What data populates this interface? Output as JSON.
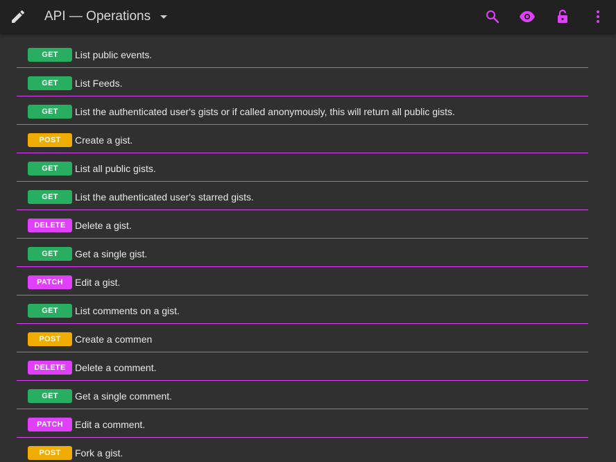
{
  "toolbar": {
    "title": "API — Operations",
    "edit_icon": "pencil-icon",
    "title_dropdown_icon": "caret-down-icon",
    "search_icon": "search-icon",
    "view_icon": "eye-icon",
    "lock_icon": "lock-icon",
    "more_icon": "more-vert-icon"
  },
  "colors": {
    "toolbar_bg": "#212121",
    "content_bg": "#303030",
    "divider": "#e040fb",
    "get": "#27ae60",
    "post": "#f0ad00",
    "delete": "#e040fb",
    "patch": "#e040fb"
  },
  "operations": [
    {
      "method": "GET",
      "summary": "List public events."
    },
    {
      "method": "GET",
      "summary": "List Feeds."
    },
    {
      "method": "GET",
      "summary": "List the authenticated user's gists or if called anonymously, this will return all public gists."
    },
    {
      "method": "POST",
      "summary": "Create a gist."
    },
    {
      "method": "GET",
      "summary": "List all public gists."
    },
    {
      "method": "GET",
      "summary": "List the authenticated user's starred gists."
    },
    {
      "method": "DELETE",
      "summary": "Delete a gist."
    },
    {
      "method": "GET",
      "summary": "Get a single gist."
    },
    {
      "method": "PATCH",
      "summary": "Edit a gist."
    },
    {
      "method": "GET",
      "summary": "List comments on a gist."
    },
    {
      "method": "POST",
      "summary": "Create a commen"
    },
    {
      "method": "DELETE",
      "summary": "Delete a comment."
    },
    {
      "method": "GET",
      "summary": "Get a single comment."
    },
    {
      "method": "PATCH",
      "summary": "Edit a comment."
    },
    {
      "method": "POST",
      "summary": "Fork a gist."
    }
  ]
}
